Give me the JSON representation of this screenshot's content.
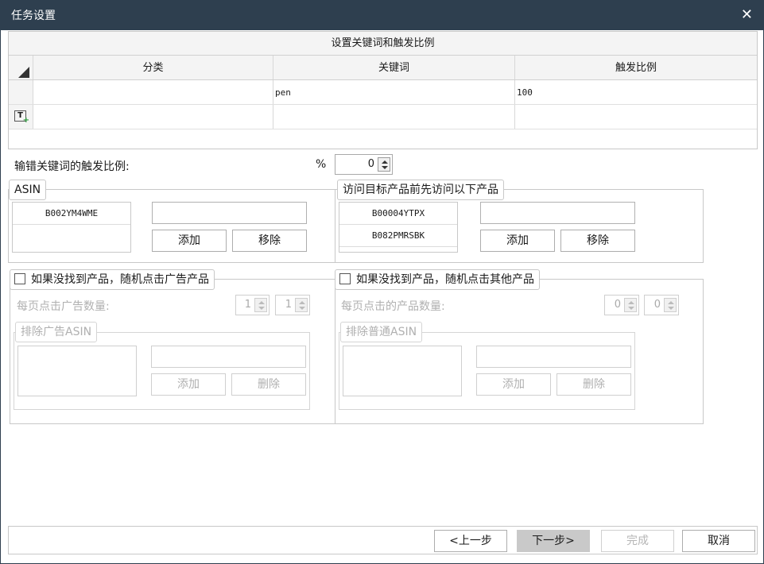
{
  "window": {
    "title": "任务设置",
    "close": "✕"
  },
  "keywords": {
    "caption": "设置关键词和触发比例",
    "columns": [
      "分类",
      "关键词",
      "触发比例"
    ],
    "rows": [
      {
        "category": "",
        "keyword": "pen",
        "ratio": "100"
      }
    ],
    "new_row_icon": "T"
  },
  "mistype": {
    "label": "输错关键词的触发比例:",
    "unit": "%",
    "value": "0"
  },
  "asin": {
    "legend": "ASIN",
    "items": [
      "B002YM4WME"
    ],
    "input_value": "",
    "add": "添加",
    "remove": "移除"
  },
  "pre_visit": {
    "legend": "访问目标产品前先访问以下产品",
    "items": [
      "B00004YTPX",
      "B082PMRSBK"
    ],
    "input_value": "",
    "add": "添加",
    "remove": "移除"
  },
  "ad_fallback": {
    "checkbox_label": "如果没找到产品，随机点击广告产品",
    "per_page_label": "每页点击广告数量:",
    "min": "1",
    "max": "1",
    "exclude_legend": "排除广告ASIN",
    "add": "添加",
    "delete": "删除"
  },
  "other_fallback": {
    "checkbox_label": "如果没找到产品，随机点击其他产品",
    "per_page_label": "每页点击的产品数量:",
    "min": "0",
    "max": "0",
    "exclude_legend": "排除普通ASIN",
    "add": "添加",
    "delete": "删除"
  },
  "footer": {
    "prev": "<上一步",
    "next": "下一步>",
    "finish": "完成",
    "cancel": "取消"
  }
}
